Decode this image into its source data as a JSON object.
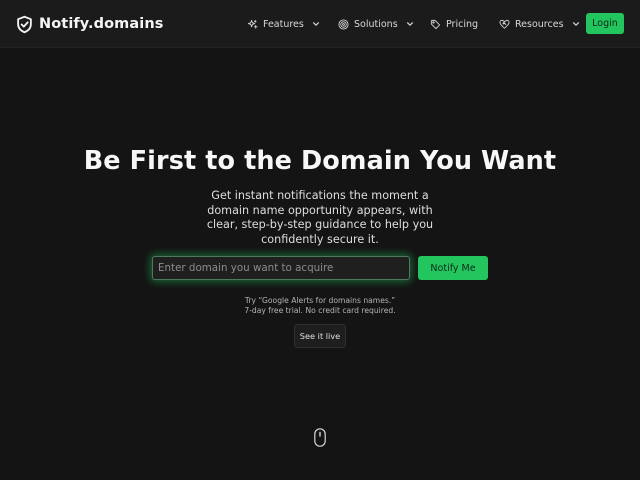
{
  "header": {
    "brand": "Notify.domains",
    "nav": [
      {
        "label": "Features",
        "icon": "sparkles-icon",
        "dropdown": true
      },
      {
        "label": "Solutions",
        "icon": "target-icon",
        "dropdown": true
      },
      {
        "label": "Pricing",
        "icon": "tag-icon",
        "dropdown": false
      },
      {
        "label": "Resources",
        "icon": "heart-handshake-icon",
        "dropdown": true
      }
    ],
    "login_label": "Login"
  },
  "hero": {
    "title": "Be First to the Domain You Want",
    "subtitle": "Get instant notifications the moment a domain name opportunity appears, with clear, step-by-step guidance to help you confidently secure it.",
    "input_placeholder": "Enter domain you want to acquire",
    "input_value": "",
    "notify_label": "Notify Me",
    "hint_line1": "Try “Google Alerts for domains names.”",
    "hint_line2": "7-day free trial. No credit card required.",
    "live_label": "See it live"
  },
  "colors": {
    "background": "#141414",
    "navbar": "#1b1b1b",
    "accent": "#22c55e"
  }
}
